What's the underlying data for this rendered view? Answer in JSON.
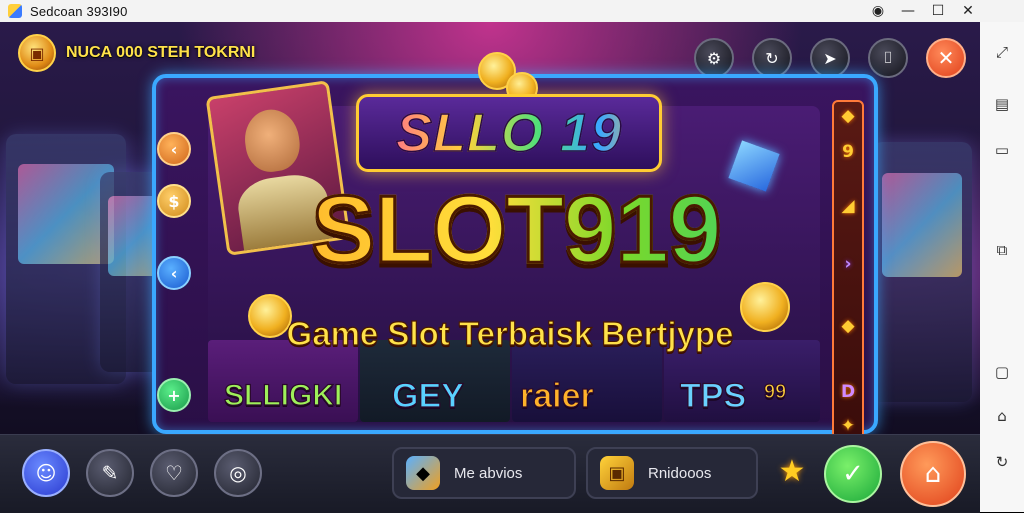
{
  "window": {
    "title": "Sedcoan 393I90",
    "controls": [
      "record-icon",
      "minimize-icon",
      "maximize-icon",
      "close-icon"
    ]
  },
  "hud": {
    "badge_text": "NUCA 000 STEH TOKRNI",
    "top_icons": [
      "settings-icon",
      "refresh-icon",
      "share-icon",
      "bookmark-icon",
      "close-icon"
    ]
  },
  "logo": {
    "top": "SLLO 19",
    "main": "SLOT919",
    "subtitle": "Game Slot Terbaisk Bertjype"
  },
  "reels": {
    "labels": [
      "SLLIGKI",
      "GEY",
      "raier",
      "TPS"
    ],
    "label_colors": [
      "#9ef05a",
      "#5ad1ff",
      "#ffb22a",
      "#6ad1ff"
    ],
    "quote": "99"
  },
  "left_controls": [
    "back-arrow-icon",
    "coin-icon",
    "prev-arrow-icon",
    "add-icon"
  ],
  "right_symbols": [
    "◆",
    "9",
    "◢",
    "",
    "›",
    "",
    "◆",
    "",
    "D",
    "✦"
  ],
  "bottom": {
    "buttons": [
      "profile-icon",
      "tools-icon",
      "heart-icon",
      "compass-icon"
    ],
    "pill_1": "Me abvios",
    "pill_2": "Rnidooos"
  },
  "emulator_sidebar": [
    "expand-icon",
    "calendar-icon",
    "screen-icon",
    "copy-icon",
    "message-icon",
    "folder-icon",
    "rotate-icon"
  ],
  "colors": {
    "frame": "#3aa8ff",
    "gold": "#ffd23a",
    "green": "#3bd16a",
    "close": "#e0401a"
  }
}
